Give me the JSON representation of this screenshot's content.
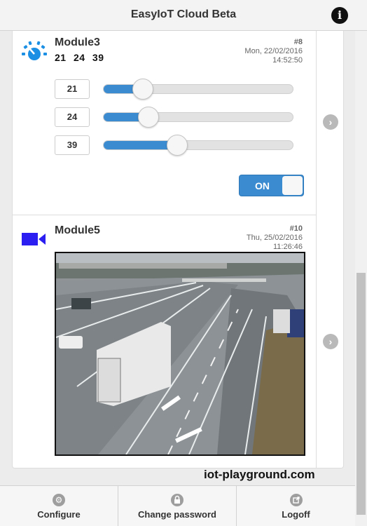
{
  "header": {
    "title": "EasyIoT Cloud Beta",
    "info_icon": "info-icon"
  },
  "modules": [
    {
      "name": "Module3",
      "values_text": "21 24 39",
      "number": "#8",
      "date": "Mon, 22/02/2016",
      "time": "14:52:50",
      "icon": "gauge-icon",
      "sliders": [
        {
          "value": "21",
          "level": 21
        },
        {
          "value": "24",
          "level": 24
        },
        {
          "value": "39",
          "level": 39
        }
      ],
      "toggle": {
        "label": "ON",
        "state": true
      }
    },
    {
      "name": "Module5",
      "number": "#10",
      "date": "Thu, 25/02/2016",
      "time": "11:26:46",
      "icon": "video-camera-icon"
    }
  ],
  "footer": {
    "configure": "Configure",
    "change_password": "Change password",
    "logoff": "Logoff"
  },
  "watermark": "iot-playground.com",
  "colors": {
    "accent": "#3b8bd0",
    "gauge": "#1a8fe3",
    "camera_icon": "#2b1ef0"
  }
}
